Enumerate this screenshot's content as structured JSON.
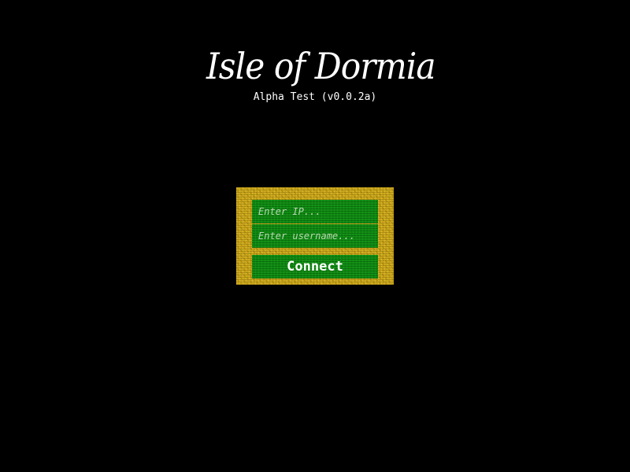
{
  "title": {
    "logo_text": "Isle of Dormia",
    "version": "Alpha Test (v0.0.2a)"
  },
  "login_form": {
    "ip_placeholder": "Enter IP...",
    "username_placeholder": "Enter username...",
    "connect_label": "Connect"
  },
  "colors": {
    "background": "#000000",
    "panel": "#c9a51a",
    "field": "#0f8a12",
    "text": "#ffffff"
  }
}
